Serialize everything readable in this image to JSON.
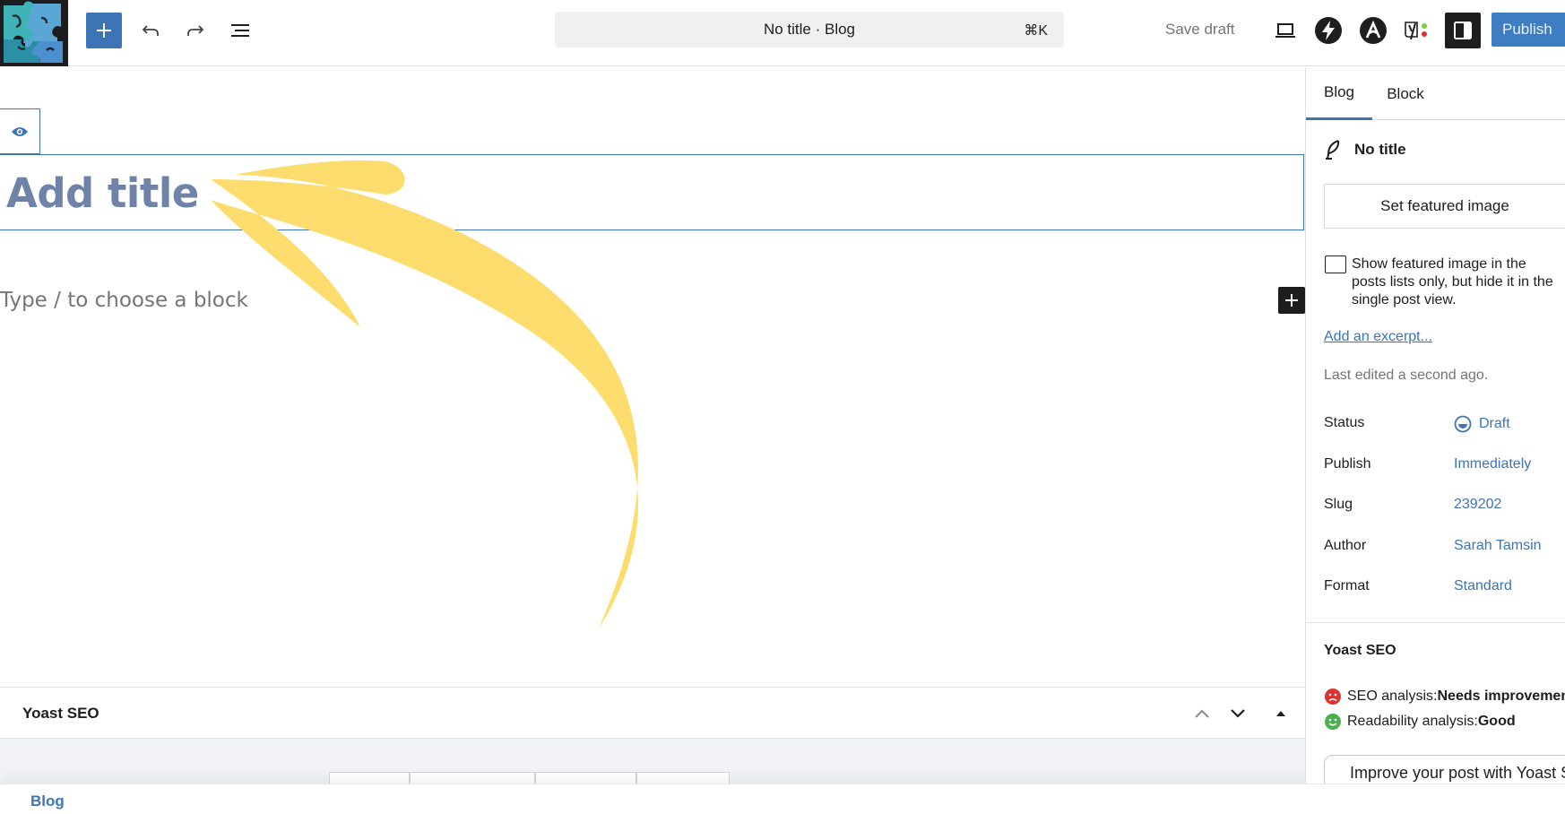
{
  "header": {
    "document_title": "No title · Blog",
    "shortcut": "⌘K",
    "save_draft": "Save draft",
    "publish": "Publish"
  },
  "editor": {
    "title_placeholder": "Add title",
    "block_placeholder": "Type / to choose a block"
  },
  "metabox": {
    "title": "Yoast SEO"
  },
  "footer": {
    "breadcrumb": "Blog"
  },
  "sidebar": {
    "tabs": [
      "Blog",
      "Block"
    ],
    "active_tab": "Blog",
    "post_title": "No title",
    "featured_image_button": "Set featured image",
    "featured_checkbox_label": "Show featured image in the posts lists only, but hide it in the single post view.",
    "featured_checkbox_checked": false,
    "excerpt_link": "Add an excerpt...",
    "last_edited": "Last edited a second ago.",
    "meta": [
      {
        "label": "Status",
        "value": "Draft"
      },
      {
        "label": "Publish",
        "value": "Immediately"
      },
      {
        "label": "Slug",
        "value": "239202"
      },
      {
        "label": "Author",
        "value": "Sarah Tamsin"
      },
      {
        "label": "Format",
        "value": "Standard"
      }
    ],
    "yoast": {
      "title": "Yoast SEO",
      "seo_label": "SEO analysis: ",
      "seo_value": "Needs improvement",
      "readability_label": "Readability analysis: ",
      "readability_value": "Good",
      "improve_button": "Improve your post with Yoast SEO"
    }
  },
  "colors": {
    "accent": "#3c74b6",
    "publish": "#3f7dc2",
    "annotation_arrow": "#fcdc6c",
    "seo_bad": "#dc3232",
    "seo_good": "#4caf50"
  },
  "icons": {
    "add": "plus-icon",
    "undo": "undo-icon",
    "redo": "redo-icon",
    "list_view": "list-view-icon",
    "preview": "laptop-icon",
    "settings": "sidebar-panel-icon",
    "post": "feather-icon",
    "status": "draft-status-icon",
    "metabox_up": "chevron-up-icon",
    "metabox_down": "chevron-down-icon",
    "metabox_toggle": "triangle-up-icon"
  }
}
